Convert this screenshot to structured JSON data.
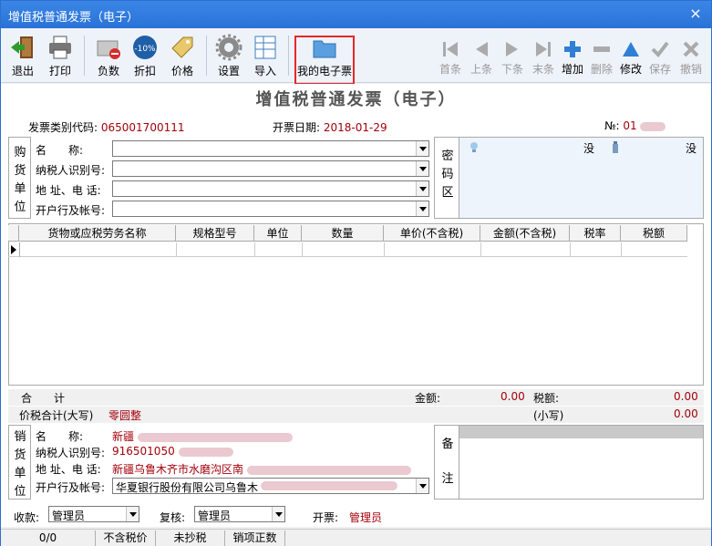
{
  "window": {
    "title": "增值税普通发票（电子）",
    "close": "×"
  },
  "toolbar": {
    "exit": "退出",
    "print": "打印",
    "negative": "负数",
    "discount": "折扣",
    "discount_badge": "-10%",
    "price": "价格",
    "settings": "设置",
    "import": "导入",
    "my_einvoice": "我的电子票",
    "first": "首条",
    "prev": "上条",
    "next": "下条",
    "last": "末条",
    "add": "增加",
    "delete": "删除",
    "modify": "修改",
    "save": "保存",
    "undo": "撤销"
  },
  "invoice": {
    "heading": "增值税普通发票（电子）",
    "type_code_label": "发票类别代码:",
    "type_code": "065001700111",
    "date_label": "开票日期:",
    "date": "2018-01-29",
    "no_label": "№:",
    "no": "01"
  },
  "buyer": {
    "section": [
      "购",
      "货",
      "单",
      "位"
    ],
    "name_label": "名　　称:",
    "tax_id_label": "纳税人识别号:",
    "address_label": "地 址、电 话:",
    "bank_label": "开户行及帐号:"
  },
  "cipher": {
    "label": [
      "密",
      "码",
      "区"
    ],
    "left": "没",
    "right": "没"
  },
  "items": {
    "columns": [
      "货物或应税劳务名称",
      "规格型号",
      "单位",
      "数量",
      "单价(不含税)",
      "金额(不含税)",
      "税率",
      "税额"
    ]
  },
  "totals": {
    "heji": "合　　计",
    "amount_label": "金额:",
    "amount": "0.00",
    "tax_label": "税额:",
    "tax": "0.00",
    "total_label": "价税合计(大写)",
    "total_text": "零圆整",
    "small_label": "(小写)",
    "small": "0.00"
  },
  "seller": {
    "section": [
      "销",
      "货",
      "单",
      "位"
    ],
    "name_label": "名　　称:",
    "name": "新疆",
    "tax_id_label": "纳税人识别号:",
    "tax_id": "916501050",
    "address_label": "地 址、电 话:",
    "address": "新疆乌鲁木齐市水磨沟区南",
    "bank_label": "开户行及帐号:",
    "bank": "华夏银行股份有限公司乌鲁木"
  },
  "remark": {
    "label": [
      "备",
      "注"
    ]
  },
  "footer": {
    "receiver_label": "收款:",
    "receiver": "管理员",
    "reviewer_label": "复核:",
    "reviewer": "管理员",
    "issuer_label": "开票:",
    "issuer": "管理员"
  },
  "status": {
    "page": "0/0",
    "price_mode": "不含税价",
    "copy": "未抄税",
    "sale": "销项正数"
  },
  "colors": {
    "title_bar": "#2a72d8",
    "red_text": "#a3000a",
    "highlight": "#e8262a"
  }
}
